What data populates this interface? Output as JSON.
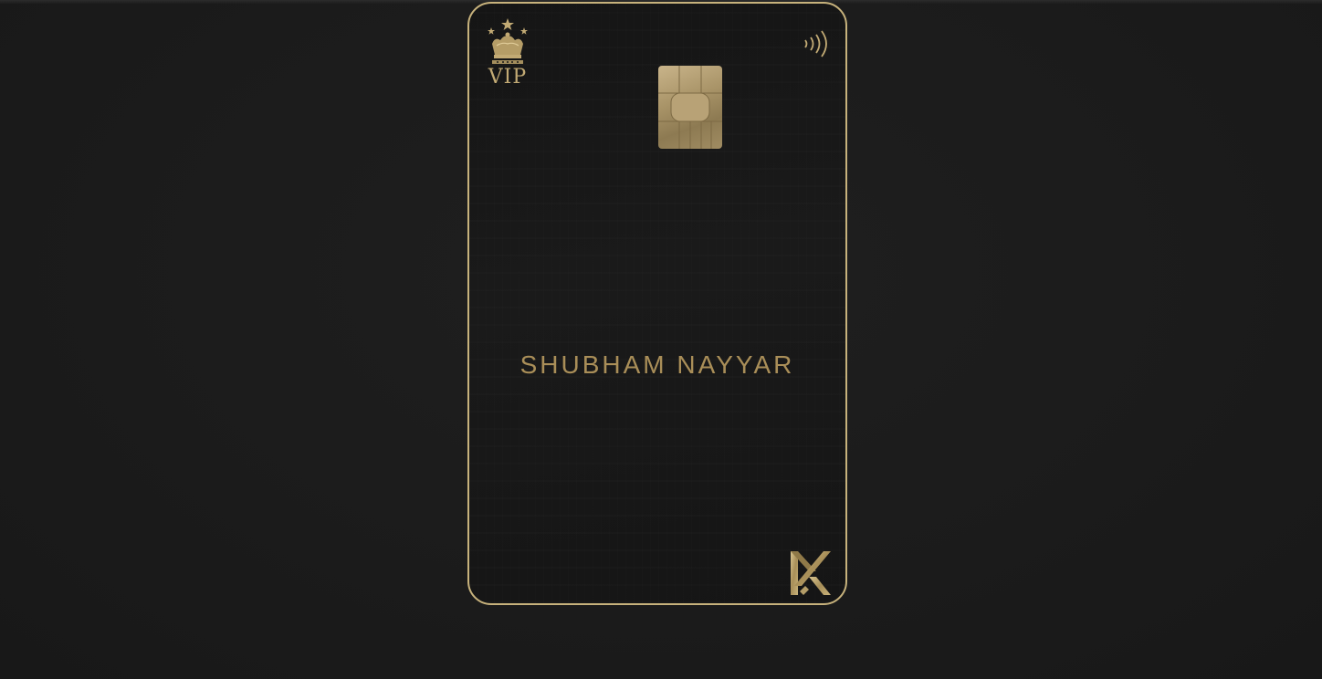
{
  "card": {
    "badge_text": "VIP",
    "holder_name": "SHUBHAM NAYYAR",
    "icons": {
      "crown": "crown-icon",
      "contactless": "contactless-icon",
      "chip": "chip-icon",
      "brand": "k-logo-icon"
    },
    "colors": {
      "background": "#1b1b1b",
      "card": "#171717",
      "gold": "#c7b27c",
      "name_text": "#a98e58"
    }
  }
}
